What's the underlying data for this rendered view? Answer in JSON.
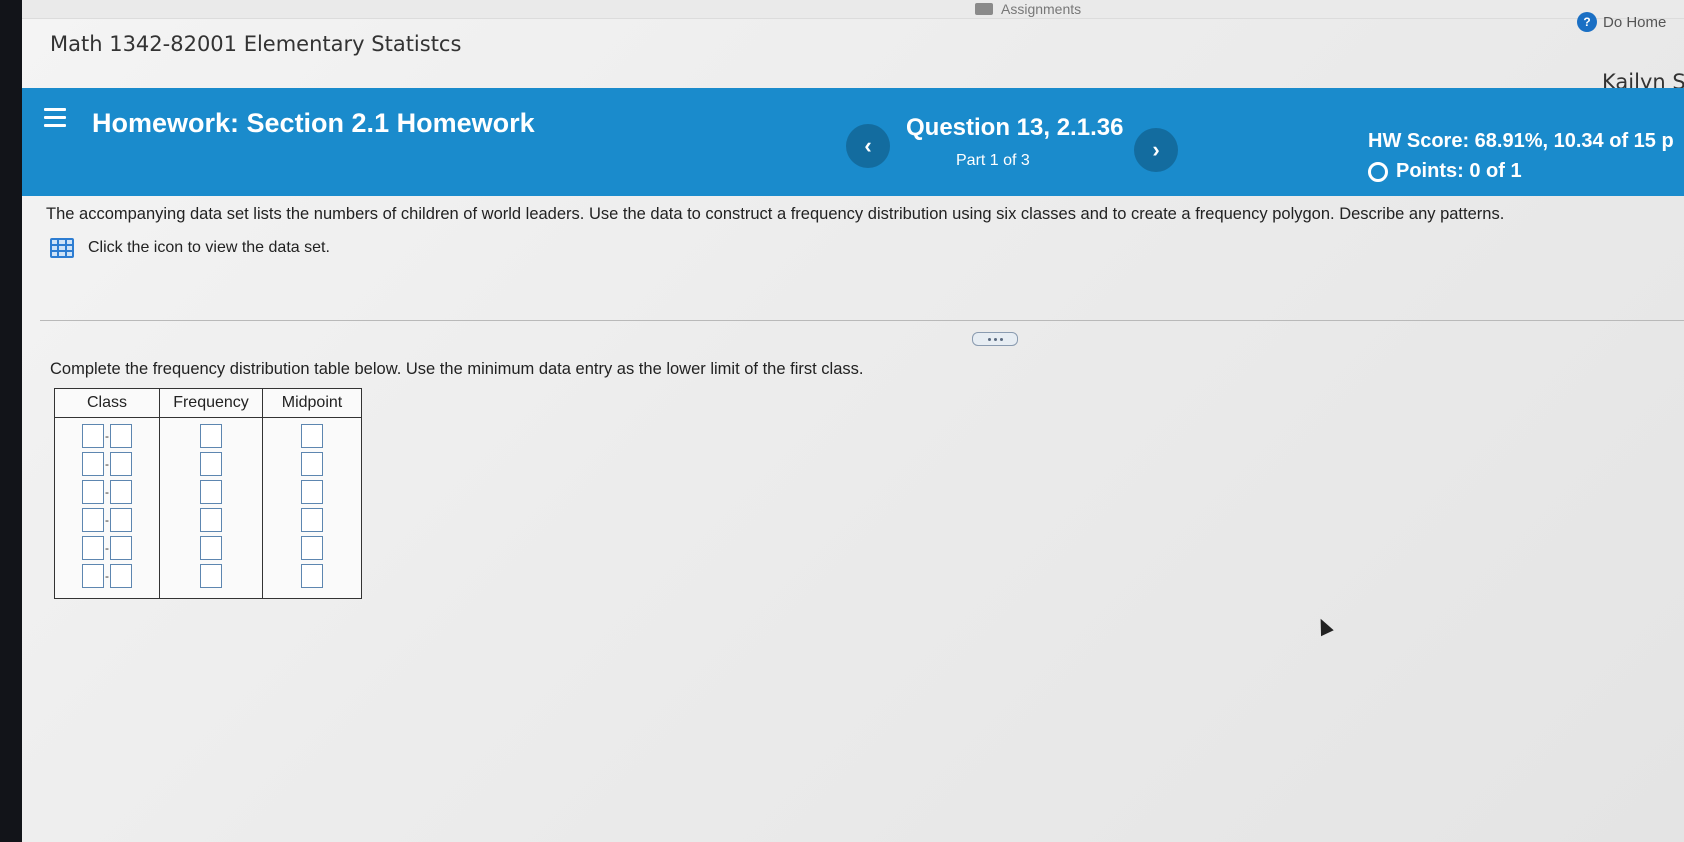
{
  "browser": {
    "tab_assignments": "Assignments",
    "do_homework": "Do Home"
  },
  "header": {
    "course_title": "Math 1342-82001 Elementary Statistcs",
    "user_name": "Kailyn S"
  },
  "toolbar": {
    "homework_title": "Homework: Section 2.1 Homework",
    "question_label": "Question 13, 2.1.36",
    "part_label": "Part 1 of 3",
    "hw_score": "HW Score: 68.91%, 10.34 of 15 p",
    "points": "Points: 0 of 1",
    "prev_symbol": "‹",
    "next_symbol": "›",
    "accent_color": "#1a8bcc"
  },
  "problem": {
    "text": "The accompanying data set lists the numbers of children of world leaders. Use the data to construct a frequency distribution using six classes and to create a frequency polygon. Describe any patterns.",
    "dataset_link": "Click the icon to view the data set.",
    "instruction": "Complete the frequency distribution table below. Use the minimum data entry as the lower limit of the first class."
  },
  "table": {
    "headers": [
      "Class",
      "Frequency",
      "Midpoint"
    ],
    "class_separator": "-"
  }
}
